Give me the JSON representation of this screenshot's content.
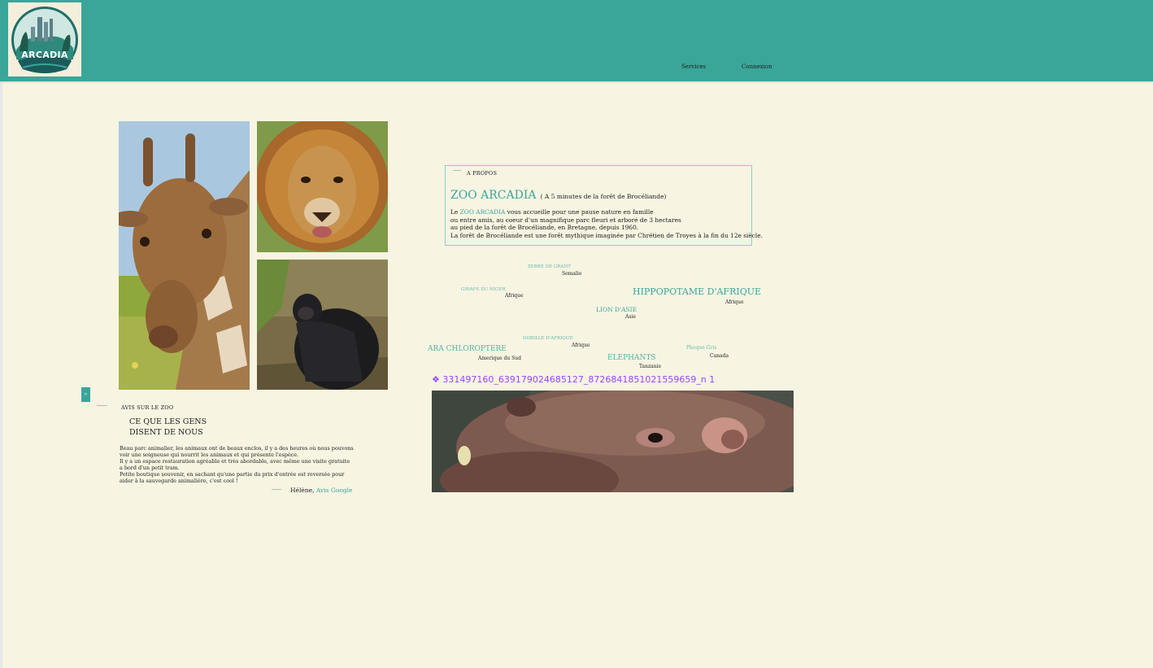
{
  "header": {
    "logo_text": "ARCADIA",
    "nav": [
      {
        "label": "Services"
      },
      {
        "label": "Connexion"
      }
    ]
  },
  "colors": {
    "header": "#3aa69a",
    "background": "#f7f4e2",
    "accent": "#3aa69a",
    "figma_label": "#9747ff"
  },
  "gallery": {
    "images": [
      {
        "subject": "giraffe"
      },
      {
        "subject": "lion"
      },
      {
        "subject": "gorilla"
      }
    ]
  },
  "about": {
    "eyebrow": "A PROPOS",
    "title": "ZOO ARCADIA",
    "subtitle": "( A 5 minutes de la forêt de  Brocéliande)",
    "p_before": "Le ",
    "p_link": "ZOO ARCADIA",
    "p_line1_rest": " vous accueille pour une pause nature en famille",
    "p_line2": "ou entre amis, au coeur d'un magnifique parc fleuri et arboré de 3 hectares",
    "p_line3": "au pied de la forêt de Brocéliande, en Bretagne, depuis 1960.",
    "p_line4": "La forêt de Brocéliande est une forêt mythique imaginée par Chrétien de Troyes à la fin du 12e siècle."
  },
  "animals": [
    {
      "name": "ZEBRE DE GRANT",
      "origin": "Somalie"
    },
    {
      "name": "GIRAFE DU NIGER",
      "origin": "Afrique"
    },
    {
      "name": "HIPPOPOTAME D'AFRIQUE",
      "origin": "Afrique"
    },
    {
      "name": "LION D'ASIE",
      "origin": "Asie"
    },
    {
      "name": "GORILLE D'AFRIQUE",
      "origin": "Afrique"
    },
    {
      "name": "Phoque Gris",
      "origin": "Canada"
    },
    {
      "name": "ARA CHLOROPTERE",
      "origin": "Amerique du Sud"
    },
    {
      "name": "ELEPHANTS",
      "origin": "Tanzanie"
    }
  ],
  "figma_component": {
    "symbol": "❖",
    "label": "331497160_639179024685127_8726841851021559659_n 1"
  },
  "carousel": {
    "prev_label": "«"
  },
  "reviews": {
    "eyebrow": "AVIS SUR LE  ZOO",
    "title_line1": "CE QUE LES GENS",
    "title_line2": "DISENT DE NOUS",
    "lines": [
      "Beau parc animalier, les animaux ont de beaux enclos, il y a des heures où nous pouvons",
      "voir une soigneuse qui nourrit les animaux et qui présente l'espèce.",
      "Il y a un espace restauration agréable et très abordable, avec même une visite gratuite",
      "a bord d'un petit tram.",
      "Petite boutique souvenir, en sachant qu'une partie du prix d'entrée est reversée pour",
      "aider à la sauvegarde animalière, c'est cool !"
    ],
    "author": "Hélène, ",
    "source": "Avis Google"
  }
}
